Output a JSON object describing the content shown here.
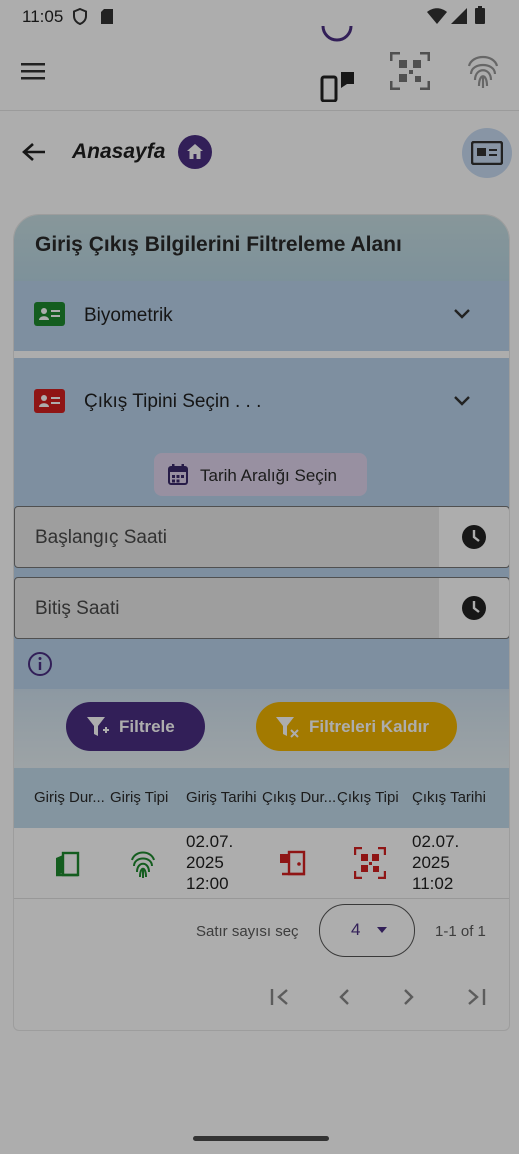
{
  "status_bar": {
    "time": "11:05"
  },
  "header": {
    "title": "Anasayfa"
  },
  "filter_card": {
    "title": "Giriş Çıkış Bilgilerini Filtreleme Alanı",
    "entry_type_select": "Biyometrik",
    "exit_type_select": "Çıkış Tipini Seçin . . .",
    "date_range_button": "Tarih Aralığı Seçin",
    "start_time_placeholder": "Başlangıç Saati",
    "end_time_placeholder": "Bitiş Saati",
    "filter_button": "Filtrele",
    "clear_filters_button": "Filtreleri Kaldır"
  },
  "table": {
    "columns": [
      "Giriş Dur...",
      "Giriş Tipi",
      "Giriş Tarihi",
      "Çıkış Dur...",
      "Çıkış Tipi",
      "Çıkış Tarihi"
    ],
    "rows": [
      {
        "entry_status_icon": "door-enter-icon",
        "entry_type_icon": "fingerprint-icon",
        "entry_date_lines": [
          "02.07.",
          "2025",
          "12:00"
        ],
        "exit_status_icon": "door-exit-icon",
        "exit_type_icon": "qr-code-icon",
        "exit_date_lines": [
          "02.07.",
          "2025",
          "11:02"
        ]
      }
    ],
    "pagination": {
      "rows_per_page_label": "Satır sayısı seç",
      "rows_per_page_value": "4",
      "range_text": "1-1 of 1"
    }
  },
  "colors": {
    "accent_purple": "#4a2f82",
    "clear_button_yellow": "#f0b400",
    "entry_green": "#1e8a2e",
    "exit_red": "#d32020",
    "panel_blue": "#bad3ec"
  }
}
